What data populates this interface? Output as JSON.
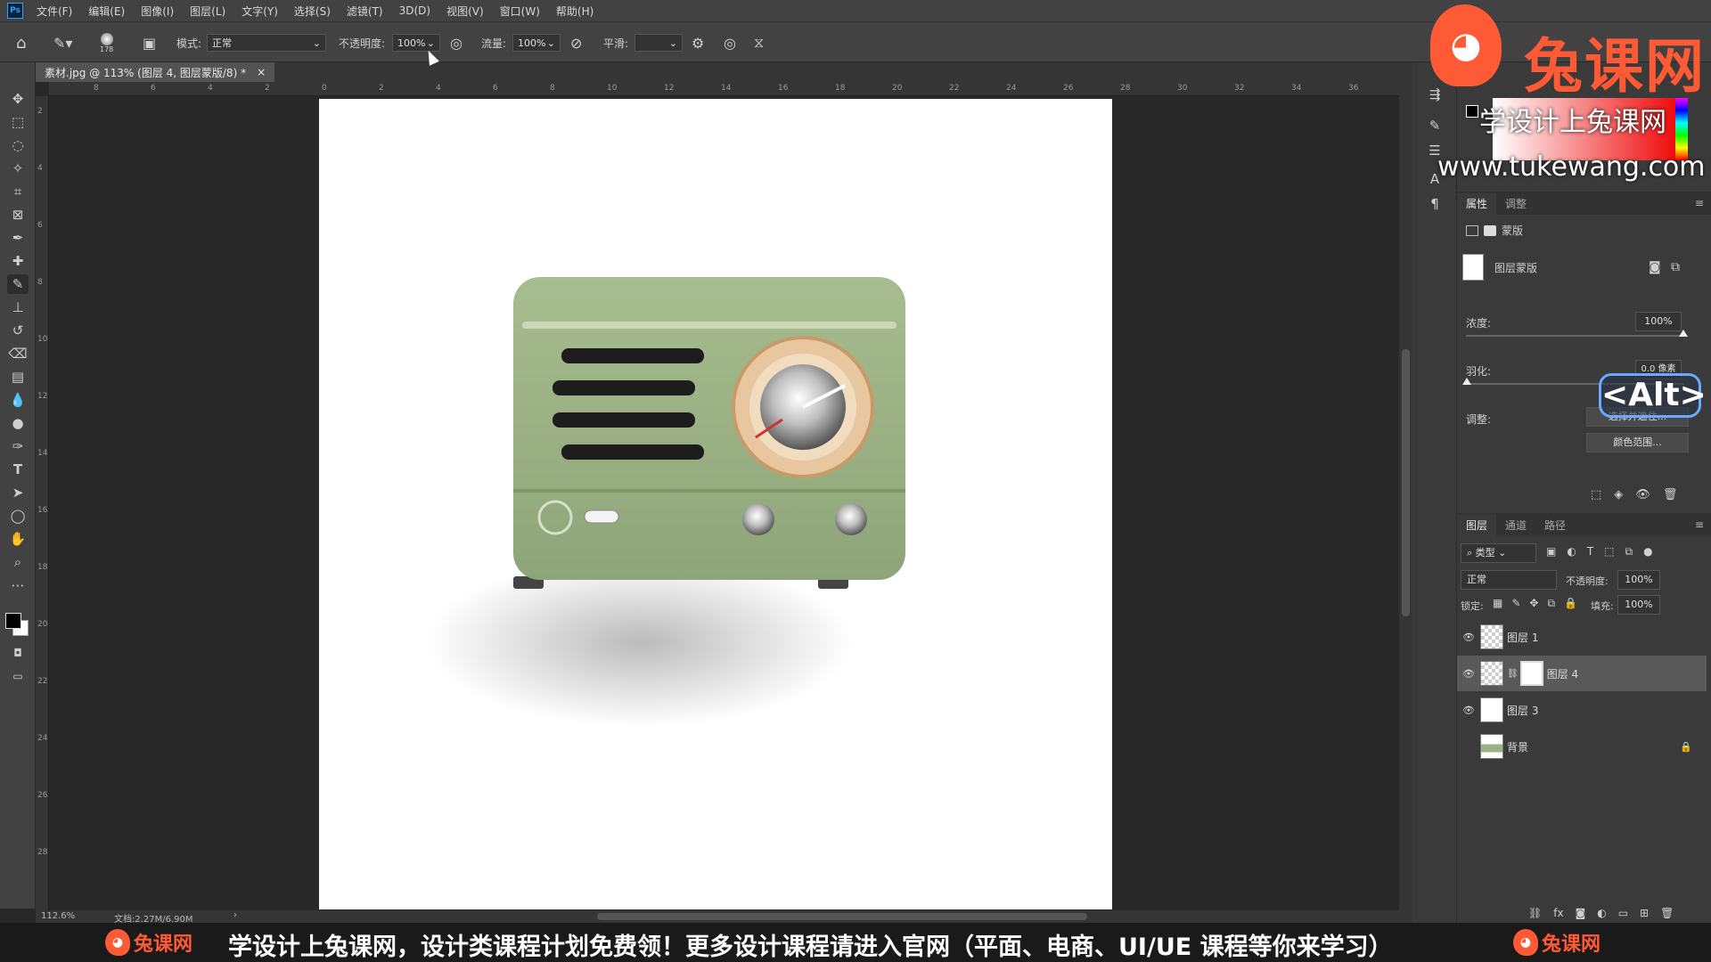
{
  "menubar": {
    "logo": "Ps",
    "items": [
      "文件(F)",
      "编辑(E)",
      "图像(I)",
      "图层(L)",
      "文字(Y)",
      "选择(S)",
      "滤镜(T)",
      "3D(D)",
      "视图(V)",
      "窗口(W)",
      "帮助(H)"
    ]
  },
  "options": {
    "brush_size": "178",
    "mode_label": "模式:",
    "mode_value": "正常",
    "opacity_label": "不透明度:",
    "opacity_value": "100%",
    "flow_label": "流量:",
    "flow_value": "100%",
    "smooth_label": "平滑:",
    "smooth_value": ""
  },
  "document": {
    "tab_title": "素材.jpg @ 113% (图层 4, 图层蒙版/8) *",
    "close": "×",
    "zoom": "112.6%",
    "doc_info": "文档:2.27M/6.90M",
    "ruler_top": [
      "8",
      "6",
      "4",
      "2",
      "0",
      "2",
      "4",
      "6",
      "8",
      "10",
      "12",
      "14",
      "16",
      "18",
      "20",
      "22",
      "24",
      "26",
      "28",
      "30",
      "32",
      "34",
      "36"
    ],
    "ruler_left": [
      "2",
      "4",
      "6",
      "8",
      "10",
      "12",
      "14",
      "16",
      "18",
      "20",
      "22",
      "24",
      "26",
      "28"
    ]
  },
  "properties": {
    "tabs": [
      "属性",
      "调整"
    ],
    "mask_label": "蒙版",
    "layer_mask_label": "图层蒙版",
    "density_label": "浓度:",
    "density_value": "100%",
    "feather_label": "羽化:",
    "feather_value": "0.0 像素",
    "adjust_label": "调整:",
    "select_and_mask": "选择并遮住...",
    "color_range": "颜色范围..."
  },
  "layers": {
    "tabs": [
      "图层",
      "通道",
      "路径"
    ],
    "filter_kind": "类型",
    "blend_mode": "正常",
    "opacity_label": "不透明度:",
    "opacity_value": "100%",
    "lock_label": "锁定:",
    "fill_label": "填充:",
    "fill_value": "100%",
    "items": [
      {
        "name": "图层 1"
      },
      {
        "name": "图层 4"
      },
      {
        "name": "图层 3"
      },
      {
        "name": "背景"
      }
    ]
  },
  "overlays": {
    "alt_key": "<Alt>",
    "watermark_name": "兔课网",
    "watermark_slogan": "学设计上兔课网",
    "watermark_url": "www.tukewang.com"
  },
  "banner": {
    "logo": "兔课网",
    "text": "学设计上兔课网，设计类课程计划免费领！更多设计课程请进入官网（平面、电商、UI/UE 课程等你来学习）"
  },
  "colors": {
    "accent_orange": "#ff5a36",
    "radio_green": "#9bb384",
    "panel_bg": "#3a3a3a"
  }
}
